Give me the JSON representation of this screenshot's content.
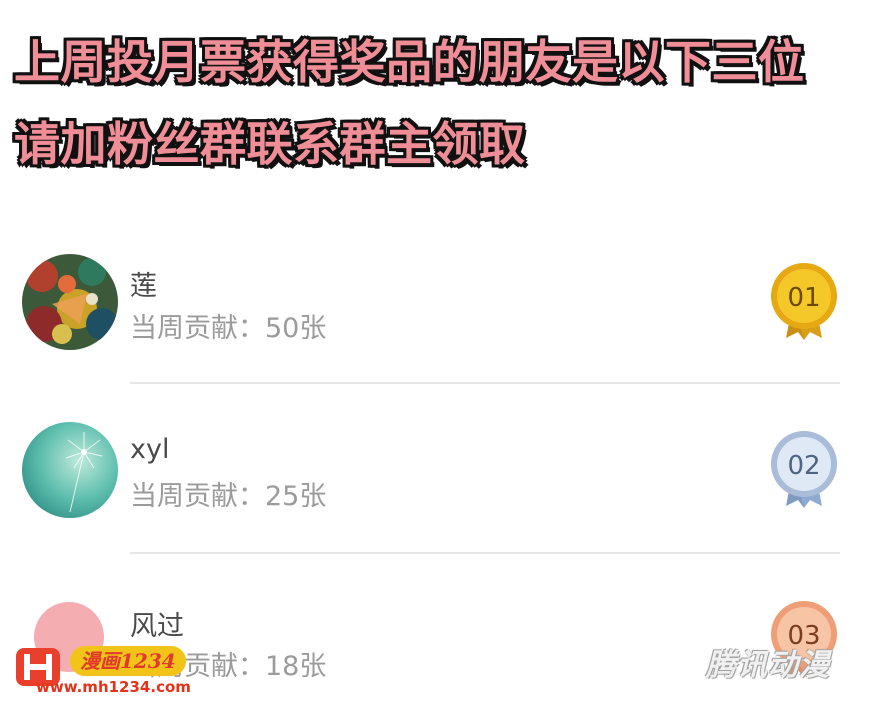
{
  "announcement": {
    "line1": "上周投月票获得奖品的朋友是以下三位",
    "line2": "请加粉丝群联系群主领取"
  },
  "ranking": [
    {
      "name": "莲",
      "contribution": "当周贡献：50张",
      "rank": "01",
      "medal_color": "#f1bf1b"
    },
    {
      "name": "xyl",
      "contribution": "当周贡献：25张",
      "rank": "02",
      "medal_color": "#c8d8ee"
    },
    {
      "name": "风过",
      "contribution": "当周贡献：18张",
      "rank": "03",
      "medal_color": "#f3b08c"
    }
  ],
  "watermark": {
    "brand": "漫画1234",
    "url": "www.mh1234.com",
    "publisher": "腾讯动漫"
  }
}
